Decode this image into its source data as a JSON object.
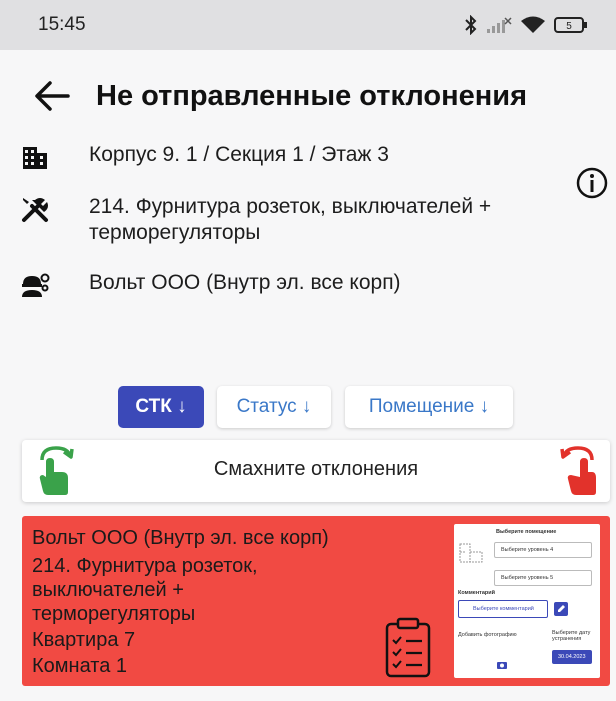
{
  "status_bar": {
    "time": "15:45",
    "battery": "5"
  },
  "header": {
    "title": "Не отправленные отклонения"
  },
  "info": {
    "location": "Корпус 9. 1 / Секция 1 / Этаж 3",
    "work_type_line1": "214. Фурнитура розеток, выключателей +",
    "work_type_line2": "терморегуляторы",
    "contractor": "Вольт ООО (Внутр эл. все корп)"
  },
  "filters": {
    "stk": "СТК ↓",
    "status": "Статус ↓",
    "room": "Помещение ↓"
  },
  "swipe_hint": "Смахните отклонения",
  "card": {
    "line1": "Вольт ООО (Внутр эл. все корп)",
    "line2": "214. Фурнитура розеток,",
    "line3": "выключателей +",
    "line4": "терморегуляторы",
    "line5": "Квартира 7",
    "line6": "Комната 1",
    "background_color": "#f14a43"
  },
  "thumbnail": {
    "title": "Выберите помещение",
    "select1": "Выберите уровень 4",
    "select2": "Выберите уровень 5",
    "comment_label": "Комментарий",
    "comment_btn": "Выберите комментарий",
    "photo_label": "Добавить фотографию",
    "date_label": "Выберите дату устранения",
    "date_value": "30.04.2023"
  },
  "colors": {
    "accent": "#3b49b8",
    "link": "#3a78c8",
    "swipe_left": "#3aa24a",
    "swipe_right": "#e2322b"
  },
  "icons": {
    "back": "arrow-left-icon",
    "location": "building-icon",
    "work_type": "tools-icon",
    "contractor": "worker-icon",
    "info": "info-icon",
    "swipe_left": "swipe-right-hand-icon",
    "swipe_right": "swipe-left-hand-icon",
    "clipboard": "checklist-clipboard-icon"
  }
}
